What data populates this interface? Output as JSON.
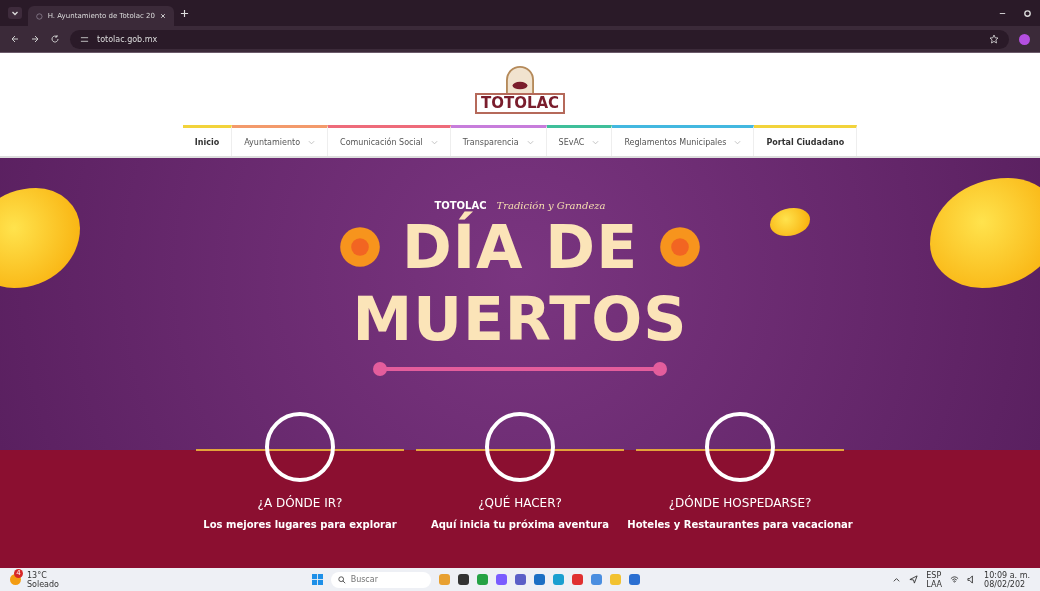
{
  "browser": {
    "tab_title": "H. Ayuntamiento de Totolac 20",
    "url": "totolac.gob.mx"
  },
  "header": {
    "logo_text": "TOTOLAC"
  },
  "nav": [
    {
      "label": "Inicio",
      "color": "#f2d33b",
      "dropdown": false,
      "bold": true
    },
    {
      "label": "Ayuntamiento",
      "color": "#f39a6b",
      "dropdown": true,
      "bold": false
    },
    {
      "label": "Comunicación Social",
      "color": "#ee6b7a",
      "dropdown": true,
      "bold": false
    },
    {
      "label": "Transparencia",
      "color": "#c77ddb",
      "dropdown": true,
      "bold": false
    },
    {
      "label": "SEvAC",
      "color": "#3fbf9a",
      "dropdown": true,
      "bold": false
    },
    {
      "label": "Reglamentos Municipales",
      "color": "#43b8e0",
      "dropdown": true,
      "bold": false
    },
    {
      "label": "Portal Ciudadano",
      "color": "#f2d33b",
      "dropdown": false,
      "bold": true
    }
  ],
  "hero": {
    "logo_text": "TOTOLAC",
    "tagline": "Tradición y Grandeza",
    "title_lines": [
      "DÍA DE",
      "MUERTOS"
    ]
  },
  "features": [
    {
      "title": "¿A DÓNDE IR?",
      "subtitle": "Los mejores lugares para explorar"
    },
    {
      "title": "¿QUÉ HACER?",
      "subtitle": "Aquí inicia tu próxima aventura"
    },
    {
      "title": "¿DÓNDE HOSPEDARSE?",
      "subtitle": "Hoteles y Restaurantes para vacacionar"
    }
  ],
  "taskbar": {
    "weather_temp": "13°C",
    "weather_text": "Soleado",
    "weather_badge": "4",
    "search_placeholder": "Buscar",
    "lang_top": "ESP",
    "lang_bottom": "LAA",
    "time": "10:09 a. m.",
    "date": "08/02/202"
  }
}
